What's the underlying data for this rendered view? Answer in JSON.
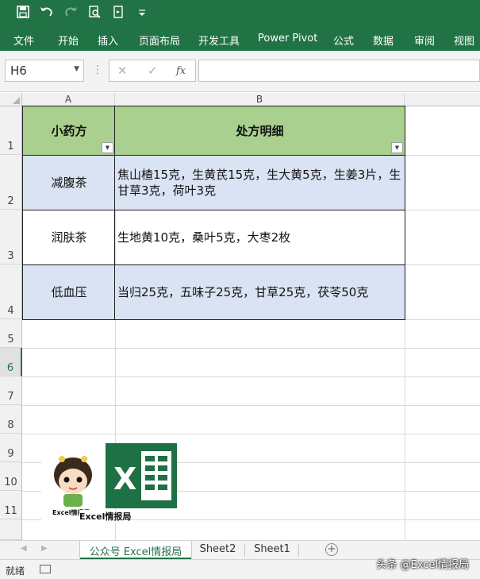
{
  "toolbar": {
    "icons": [
      "save-icon",
      "undo-icon",
      "redo-icon",
      "print-preview-icon",
      "document-icon",
      "customize-icon"
    ]
  },
  "ribbon": {
    "tabs": [
      "文件",
      "开始",
      "插入",
      "页面布局",
      "开发工具",
      "Power Pivot",
      "公式",
      "数据",
      "审阅",
      "视图"
    ]
  },
  "formula_bar": {
    "name_box": "H6",
    "cancel": "✕",
    "enter": "✓",
    "fx": "fx",
    "value": ""
  },
  "columns": [
    "A",
    "B"
  ],
  "rows": [
    "1",
    "2",
    "3",
    "4",
    "5",
    "6",
    "7",
    "8",
    "9",
    "10",
    "11"
  ],
  "table": {
    "header": {
      "a": "小药方",
      "b": "处方明细"
    },
    "rows": [
      {
        "name": "减腹茶",
        "detail": "焦山楂15克，生黄芪15克，生大黄5克，生姜3片，生甘草3克，荷叶3克"
      },
      {
        "name": "润肤茶",
        "detail": "生地黄10克，桑叶5克，大枣2枚"
      },
      {
        "name": "低血压",
        "detail": "当归25克，五味子25克，甘草25克，茯苓50克"
      }
    ]
  },
  "logo": {
    "text": "Excel情报局",
    "small_text": "Excel情报局",
    "letter": "X"
  },
  "sheets": {
    "tabs": [
      "公众号 Excel情报局",
      "Sheet2",
      "Sheet1"
    ],
    "active": 0
  },
  "status": {
    "ready": "就绪"
  },
  "watermark": "头条 @Excel情报局",
  "colors": {
    "accent": "#217346",
    "header_fill": "#a9d08e",
    "band_fill": "#dae3f3"
  }
}
